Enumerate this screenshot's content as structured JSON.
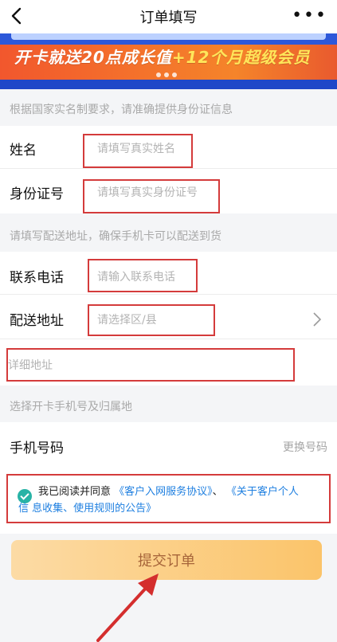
{
  "header": {
    "title": "订单填写",
    "more_label": "•••"
  },
  "banner": {
    "text_part1": "开卡就送20点成长值",
    "text_part2": "+12个月超级会员"
  },
  "sections": {
    "identity_hint": "根据国家实名制要求，请准确提供身份证信息",
    "delivery_hint": "请填写配送地址，确保手机卡可以配送到货",
    "number_hint": "选择开卡手机号及归属地"
  },
  "fields": {
    "name_label": "姓名",
    "name_placeholder": "请填写真实姓名",
    "id_label": "身份证号",
    "id_placeholder": "请填写真实身份证号",
    "phone_label": "联系电话",
    "phone_placeholder": "请输入联系电话",
    "address_label": "配送地址",
    "address_placeholder": "请选择区/县",
    "detail_placeholder": "详细地址"
  },
  "phone_number": {
    "label": "手机号码",
    "change": "更换号码"
  },
  "agreement": {
    "prefix": "我已阅读并同意",
    "link1": "《客户入网服务协议》",
    "sep": "、",
    "link2_part1": "《关于客户个人",
    "link2_part2": "信 息收集、使用规则的公告》"
  },
  "submit": {
    "label": "提交订单"
  },
  "colors": {
    "accent_red": "#d43b3b",
    "link_blue": "#1e7fe0",
    "check_teal": "#28b3a6",
    "button_gradient_start": "#fcdba5",
    "button_gradient_end": "#fbc46a"
  }
}
